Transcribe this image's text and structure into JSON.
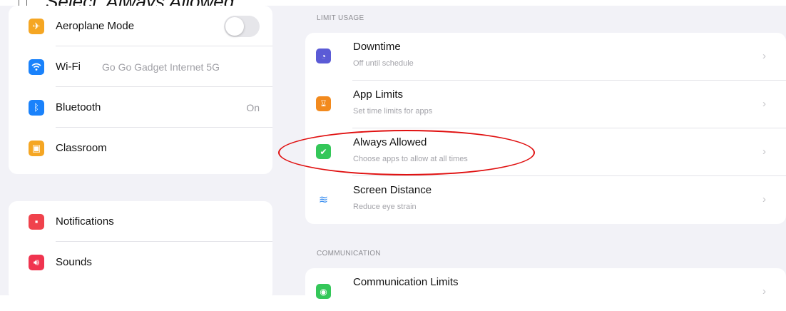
{
  "caption": {
    "bullet": "□",
    "text": "Select 'Always Allowed'"
  },
  "left": {
    "group1": [
      {
        "label": "Aeroplane Mode",
        "icon": "airplane-icon",
        "color": "#f5a623"
      },
      {
        "label": "Wi-Fi",
        "value": "Go Go Gadget Internet 5G",
        "icon": "wifi-icon",
        "color": "#1a82fb"
      },
      {
        "label": "Bluetooth",
        "value": "On",
        "icon": "bluetooth-icon",
        "color": "#1a82fb"
      },
      {
        "label": "Classroom",
        "icon": "classroom-icon",
        "color": "#f5a623"
      }
    ],
    "group2": [
      {
        "label": "Notifications",
        "icon": "notifications-icon",
        "color": "#f0424c"
      },
      {
        "label": "Sounds",
        "icon": "sounds-icon",
        "color": "#f0344f"
      }
    ]
  },
  "right": {
    "limit_usage_header": "LIMIT USAGE",
    "limit_usage": [
      {
        "title": "Downtime",
        "subtitle": "Off until schedule",
        "icon": "downtime-icon",
        "color": "#5b5bd6"
      },
      {
        "title": "App Limits",
        "subtitle": "Set time limits for apps",
        "icon": "hourglass-icon",
        "color": "#f28a1e"
      },
      {
        "title": "Always Allowed",
        "subtitle": "Choose apps to allow at all times",
        "icon": "checkmark-icon",
        "color": "#34c759"
      },
      {
        "title": "Screen Distance",
        "subtitle": "Reduce eye strain",
        "icon": "screen-distance-icon",
        "color": "#3a8ef0"
      }
    ],
    "communication_header": "COMMUNICATION",
    "communication": [
      {
        "title": "Communication Limits",
        "icon": "communication-icon",
        "color": "#34c759"
      }
    ]
  }
}
